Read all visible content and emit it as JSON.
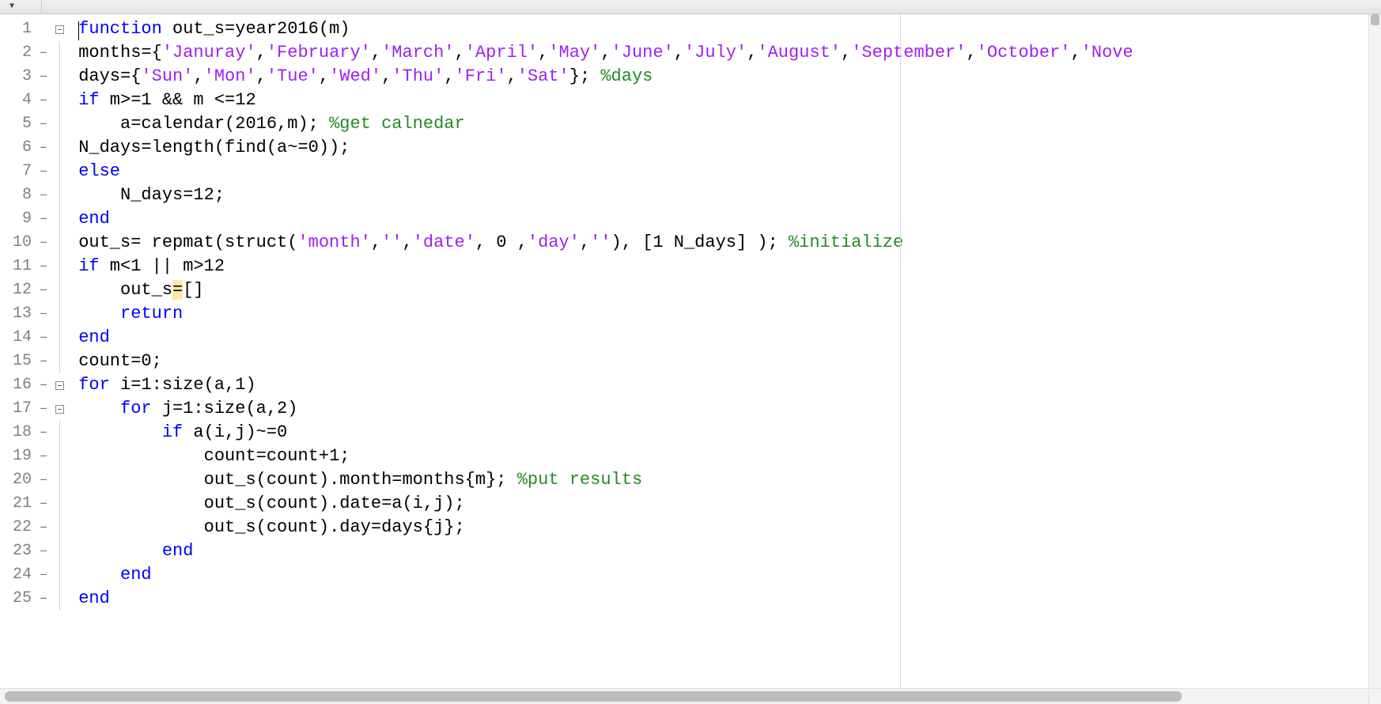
{
  "lines": [
    {
      "num": 1,
      "dash": false,
      "fold": "box",
      "indent": 0,
      "cursor": true,
      "tokens": [
        {
          "t": "keyword",
          "v": "function"
        },
        {
          "t": "normal",
          "v": " out_s=year2016(m)"
        }
      ]
    },
    {
      "num": 2,
      "dash": true,
      "fold": "line",
      "indent": 0,
      "tokens": [
        {
          "t": "normal",
          "v": "months={"
        },
        {
          "t": "string",
          "v": "'Januray'"
        },
        {
          "t": "normal",
          "v": ","
        },
        {
          "t": "string",
          "v": "'February'"
        },
        {
          "t": "normal",
          "v": ","
        },
        {
          "t": "string",
          "v": "'March'"
        },
        {
          "t": "normal",
          "v": ","
        },
        {
          "t": "string",
          "v": "'April'"
        },
        {
          "t": "normal",
          "v": ","
        },
        {
          "t": "string",
          "v": "'May'"
        },
        {
          "t": "normal",
          "v": ","
        },
        {
          "t": "string",
          "v": "'June'"
        },
        {
          "t": "normal",
          "v": ","
        },
        {
          "t": "string",
          "v": "'July'"
        },
        {
          "t": "normal",
          "v": ","
        },
        {
          "t": "string",
          "v": "'August'"
        },
        {
          "t": "normal",
          "v": ","
        },
        {
          "t": "string",
          "v": "'September'"
        },
        {
          "t": "normal",
          "v": ","
        },
        {
          "t": "string",
          "v": "'October'"
        },
        {
          "t": "normal",
          "v": ","
        },
        {
          "t": "string",
          "v": "'Nove"
        }
      ]
    },
    {
      "num": 3,
      "dash": true,
      "fold": "line",
      "indent": 0,
      "tokens": [
        {
          "t": "normal",
          "v": "days={"
        },
        {
          "t": "string",
          "v": "'Sun'"
        },
        {
          "t": "normal",
          "v": ","
        },
        {
          "t": "string",
          "v": "'Mon'"
        },
        {
          "t": "normal",
          "v": ","
        },
        {
          "t": "string",
          "v": "'Tue'"
        },
        {
          "t": "normal",
          "v": ","
        },
        {
          "t": "string",
          "v": "'Wed'"
        },
        {
          "t": "normal",
          "v": ","
        },
        {
          "t": "string",
          "v": "'Thu'"
        },
        {
          "t": "normal",
          "v": ","
        },
        {
          "t": "string",
          "v": "'Fri'"
        },
        {
          "t": "normal",
          "v": ","
        },
        {
          "t": "string",
          "v": "'Sat'"
        },
        {
          "t": "normal",
          "v": "}; "
        },
        {
          "t": "comment",
          "v": "%days"
        }
      ]
    },
    {
      "num": 4,
      "dash": true,
      "fold": "line",
      "indent": 0,
      "tokens": [
        {
          "t": "keyword",
          "v": "if"
        },
        {
          "t": "normal",
          "v": " m>=1 && m <=12"
        }
      ]
    },
    {
      "num": 5,
      "dash": true,
      "fold": "line",
      "indent": 1,
      "tokens": [
        {
          "t": "normal",
          "v": "a=calendar(2016,m); "
        },
        {
          "t": "comment",
          "v": "%get calnedar"
        }
      ]
    },
    {
      "num": 6,
      "dash": true,
      "fold": "line",
      "indent": 0,
      "tokens": [
        {
          "t": "normal",
          "v": "N_days=length(find(a~=0));"
        }
      ]
    },
    {
      "num": 7,
      "dash": true,
      "fold": "line",
      "indent": 0,
      "tokens": [
        {
          "t": "keyword",
          "v": "else"
        }
      ]
    },
    {
      "num": 8,
      "dash": true,
      "fold": "line",
      "indent": 1,
      "tokens": [
        {
          "t": "normal",
          "v": "N_days=12;"
        }
      ]
    },
    {
      "num": 9,
      "dash": true,
      "fold": "line",
      "indent": 0,
      "tokens": [
        {
          "t": "keyword",
          "v": "end"
        }
      ]
    },
    {
      "num": 10,
      "dash": true,
      "fold": "line",
      "indent": 0,
      "tokens": [
        {
          "t": "normal",
          "v": "out_s= repmat(struct("
        },
        {
          "t": "string",
          "v": "'month'"
        },
        {
          "t": "normal",
          "v": ","
        },
        {
          "t": "string",
          "v": "''"
        },
        {
          "t": "normal",
          "v": ","
        },
        {
          "t": "string",
          "v": "'date'"
        },
        {
          "t": "normal",
          "v": ", 0 ,"
        },
        {
          "t": "string",
          "v": "'day'"
        },
        {
          "t": "normal",
          "v": ","
        },
        {
          "t": "string",
          "v": "''"
        },
        {
          "t": "normal",
          "v": "), [1 N_days] ); "
        },
        {
          "t": "comment",
          "v": "%initialize"
        }
      ]
    },
    {
      "num": 11,
      "dash": true,
      "fold": "line",
      "indent": 0,
      "tokens": [
        {
          "t": "keyword",
          "v": "if"
        },
        {
          "t": "normal",
          "v": " m<1 || m>12"
        }
      ]
    },
    {
      "num": 12,
      "dash": true,
      "fold": "line",
      "indent": 1,
      "tokens": [
        {
          "t": "normal",
          "v": "out_s"
        },
        {
          "t": "normal",
          "v": "=",
          "hl": true
        },
        {
          "t": "normal",
          "v": "[]"
        }
      ]
    },
    {
      "num": 13,
      "dash": true,
      "fold": "line",
      "indent": 1,
      "tokens": [
        {
          "t": "keyword",
          "v": "return"
        }
      ]
    },
    {
      "num": 14,
      "dash": true,
      "fold": "line",
      "indent": 0,
      "tokens": [
        {
          "t": "keyword",
          "v": "end"
        }
      ]
    },
    {
      "num": 15,
      "dash": true,
      "fold": "line",
      "indent": 0,
      "tokens": [
        {
          "t": "normal",
          "v": "count=0;"
        }
      ]
    },
    {
      "num": 16,
      "dash": true,
      "fold": "box",
      "indent": 0,
      "tokens": [
        {
          "t": "keyword",
          "v": "for"
        },
        {
          "t": "normal",
          "v": " i=1:size(a,1)"
        }
      ]
    },
    {
      "num": 17,
      "dash": true,
      "fold": "box",
      "indent": 1,
      "tokens": [
        {
          "t": "keyword",
          "v": "for"
        },
        {
          "t": "normal",
          "v": " j=1:size(a,2)"
        }
      ]
    },
    {
      "num": 18,
      "dash": true,
      "fold": "line",
      "indent": 2,
      "tokens": [
        {
          "t": "keyword",
          "v": "if"
        },
        {
          "t": "normal",
          "v": " a(i,j)~=0"
        }
      ]
    },
    {
      "num": 19,
      "dash": true,
      "fold": "line",
      "indent": 3,
      "tokens": [
        {
          "t": "normal",
          "v": "count=count+1;"
        }
      ]
    },
    {
      "num": 20,
      "dash": true,
      "fold": "line",
      "indent": 3,
      "tokens": [
        {
          "t": "normal",
          "v": "out_s(count).month=months{m}; "
        },
        {
          "t": "comment",
          "v": "%put results"
        }
      ]
    },
    {
      "num": 21,
      "dash": true,
      "fold": "line",
      "indent": 3,
      "tokens": [
        {
          "t": "normal",
          "v": "out_s(count).date=a(i,j);"
        }
      ]
    },
    {
      "num": 22,
      "dash": true,
      "fold": "line",
      "indent": 3,
      "tokens": [
        {
          "t": "normal",
          "v": "out_s(count).day=days{j};"
        }
      ]
    },
    {
      "num": 23,
      "dash": true,
      "fold": "line",
      "indent": 2,
      "tokens": [
        {
          "t": "keyword",
          "v": "end"
        }
      ]
    },
    {
      "num": 24,
      "dash": true,
      "fold": "line",
      "indent": 1,
      "tokens": [
        {
          "t": "keyword",
          "v": "end"
        }
      ]
    },
    {
      "num": 25,
      "dash": true,
      "fold": "line",
      "indent": 0,
      "tokens": [
        {
          "t": "keyword",
          "v": "end"
        }
      ]
    }
  ],
  "ui": {
    "menu_arrow": "▼",
    "dash_glyph": "–"
  }
}
